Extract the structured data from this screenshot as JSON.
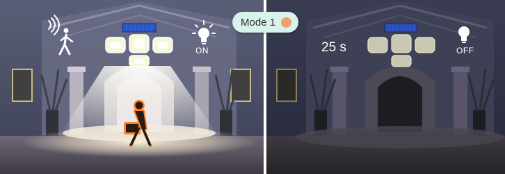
{
  "mode_badge": {
    "label": "Mode 1",
    "dot_color": "#f0a06a"
  },
  "left_panel": {
    "state": "motion-detected",
    "light_status": "ON"
  },
  "right_panel": {
    "state": "idle",
    "countdown": "25 s",
    "light_status": "OFF"
  },
  "icons": {
    "motion": "motion-sensor-walking-person-icon",
    "bulb_on": "light-bulb-on-icon",
    "bulb_off": "light-bulb-off-icon"
  },
  "colors": {
    "person_glow": "#ff7a1a",
    "divider": "#ffffff"
  }
}
